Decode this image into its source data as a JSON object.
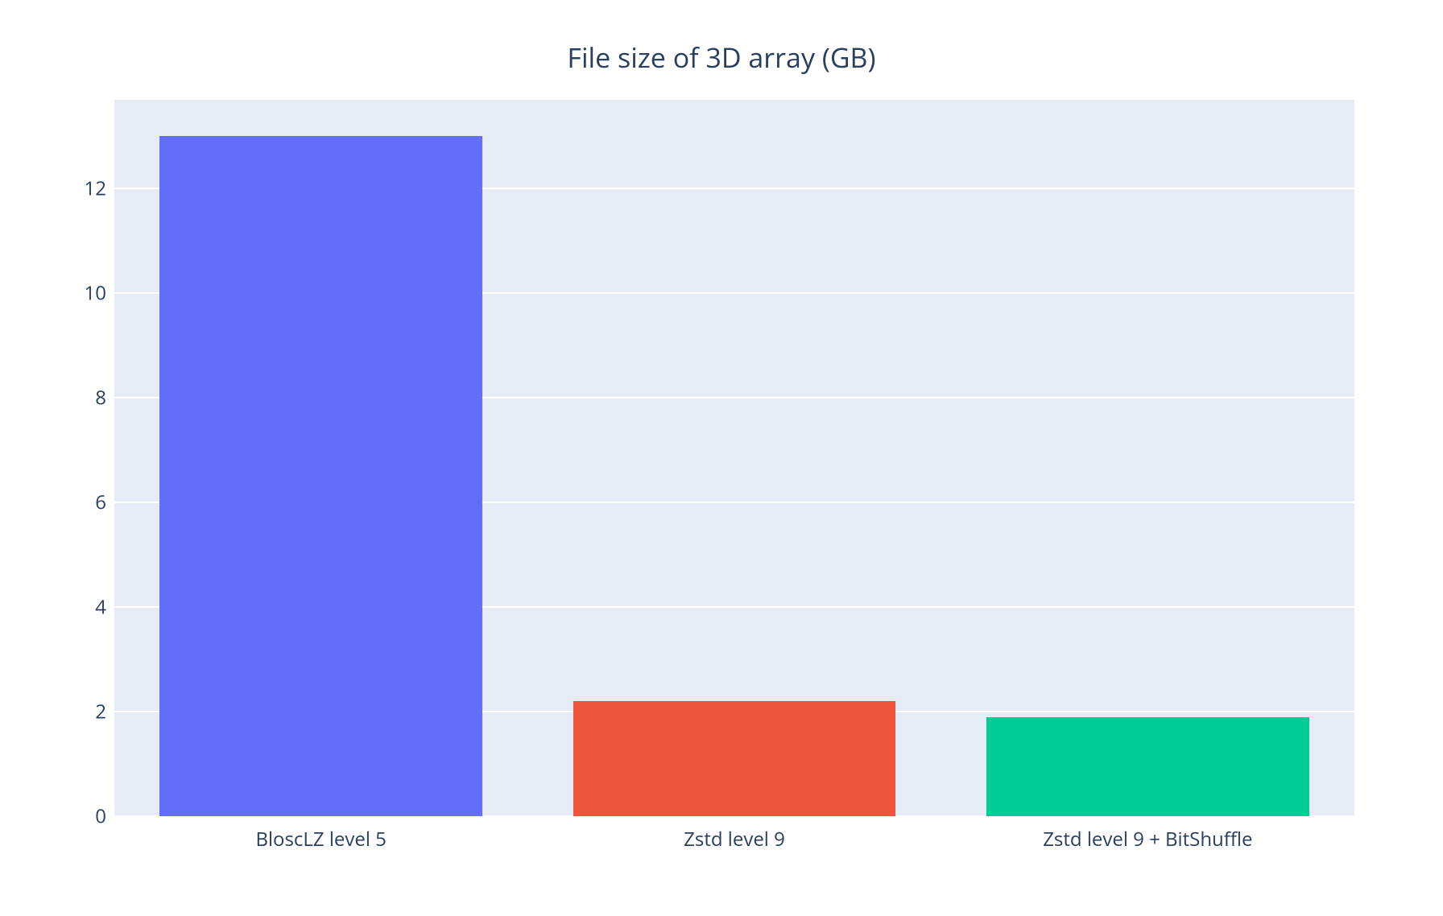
{
  "chart_data": {
    "type": "bar",
    "title": "File size of 3D array (GB)",
    "xlabel": "",
    "ylabel": "",
    "categories": [
      "BloscLZ level 5",
      "Zstd level 9",
      "Zstd level 9 + BitShuffle"
    ],
    "values": [
      13.0,
      2.2,
      1.9
    ],
    "colors": [
      "#636efa",
      "#ef553b",
      "#00cc96"
    ],
    "y_ticks": [
      0,
      2,
      4,
      6,
      8,
      10,
      12
    ],
    "ylim": [
      0,
      13.7
    ]
  }
}
